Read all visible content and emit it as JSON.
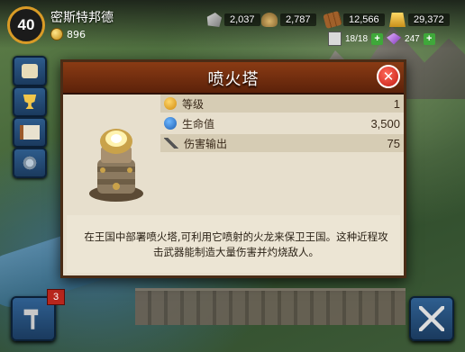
{
  "player": {
    "level": "40",
    "name": "密斯特邦德",
    "gold": "896"
  },
  "resources": {
    "stone": "2,037",
    "food": "2,787",
    "wood": "12,566",
    "gold_bars": "29,372"
  },
  "troops": {
    "capacity": "18/18",
    "gems": "247"
  },
  "build_badge": "3",
  "modal": {
    "title": "喷火塔",
    "close": "✕",
    "stats": [
      {
        "label": "等级",
        "value": "1",
        "icon": "level-up-icon"
      },
      {
        "label": "生命值",
        "value": "3,500",
        "icon": "health-icon"
      },
      {
        "label": "伤害输出",
        "value": "75",
        "icon": "damage-icon"
      }
    ],
    "description": "在王国中部署喷火塔,可利用它喷射的火龙来保卫王国。这种近程攻击武器能制造大量伤害并灼烧敌人。"
  },
  "colors": {
    "header": "#7a3210",
    "panel": "#e7dfcd",
    "close": "#d4241a",
    "accent_ring": "#d99b26"
  }
}
